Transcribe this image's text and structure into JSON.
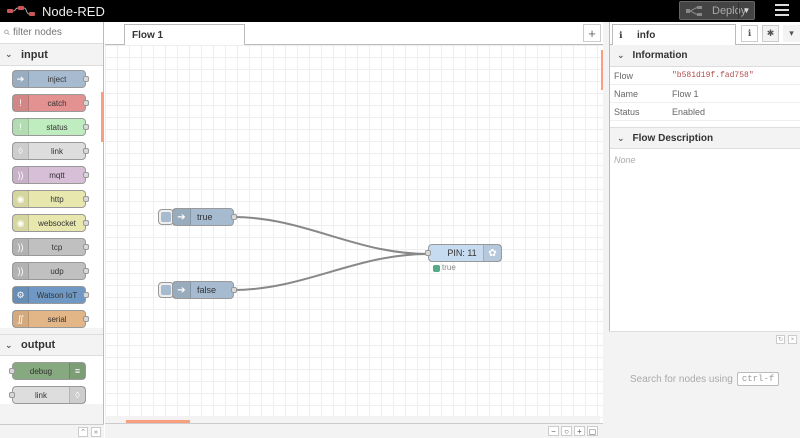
{
  "header": {
    "app_name": "Node-RED",
    "deploy_label": "Deploy"
  },
  "palette": {
    "filter_placeholder": "filter nodes",
    "categories": [
      {
        "name": "input",
        "nodes": [
          {
            "label": "inject",
            "color": "#a6bbcf",
            "icon": "arrow-in-icon"
          },
          {
            "label": "catch",
            "color": "#e49191",
            "icon": "exclamation-icon"
          },
          {
            "label": "status",
            "color": "#c0edc0",
            "icon": "exclamation-icon"
          },
          {
            "label": "link",
            "color": "#dddddd",
            "icon": "link-icon"
          },
          {
            "label": "mqtt",
            "color": "#d8bfd8",
            "icon": "wave-icon"
          },
          {
            "label": "http",
            "color": "#e7e7ae",
            "icon": "globe-icon"
          },
          {
            "label": "websocket",
            "color": "#e7e7ae",
            "icon": "globe-icon"
          },
          {
            "label": "tcp",
            "color": "#c0c0c0",
            "icon": "wave-icon"
          },
          {
            "label": "udp",
            "color": "#c0c0c0",
            "icon": "wave-icon"
          },
          {
            "label": "Watson IoT",
            "color": "#6f99c4",
            "icon": "gear-icon"
          },
          {
            "label": "serial",
            "color": "#e3b687",
            "icon": "serial-icon"
          }
        ]
      },
      {
        "name": "output",
        "nodes": [
          {
            "label": "debug",
            "color": "#87a980",
            "icon": "list-icon"
          },
          {
            "label": "link",
            "color": "#dddddd",
            "icon": "link-icon"
          }
        ]
      }
    ]
  },
  "workspace": {
    "tab_label": "Flow 1",
    "nodes": {
      "inject_true": {
        "label": "true"
      },
      "inject_false": {
        "label": "false"
      },
      "pin": {
        "label": "PIN: 11",
        "status": "true"
      }
    }
  },
  "sidebar": {
    "tab_label": "info",
    "information_header": "Information",
    "rows": [
      {
        "key": "Flow",
        "value": "\"b581d19f.fad758\""
      },
      {
        "key": "Name",
        "value": "Flow 1"
      },
      {
        "key": "Status",
        "value": "Enabled"
      }
    ],
    "description_header": "Flow Description",
    "description": "None",
    "help_text": "Search for nodes using",
    "help_shortcut": "ctrl-f"
  }
}
